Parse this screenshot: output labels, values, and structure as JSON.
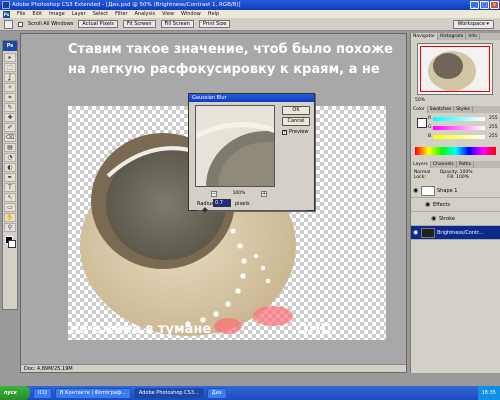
{
  "window": {
    "title": "Adobe Photoshop CS3 Extended - [Диз.psd @ 50% (Brightness/Contrast 1, RGB/8)]",
    "controls": [
      "_",
      "□",
      "x"
    ]
  },
  "menu": {
    "logo": "Ps",
    "items": [
      "File",
      "Edit",
      "Image",
      "Layer",
      "Select",
      "Filter",
      "Analysis",
      "View",
      "Window",
      "Help"
    ]
  },
  "options": {
    "scroll_all_label": "Scroll All Windows",
    "buttons": [
      "Actual Pixels",
      "Fit Screen",
      "Fill Screen",
      "Print Size"
    ],
    "workspace_label": "Workspace ▾"
  },
  "toolbox": {
    "logo": "Ps",
    "tools": [
      "▸",
      "⬚",
      "ʆ",
      "✧",
      "⌗",
      "✎",
      "✚",
      "✐",
      "⌫",
      "▤",
      "◔",
      "◐",
      "✒",
      "T",
      "↖",
      "▭",
      "✋",
      "⚲"
    ]
  },
  "annotation": {
    "main_text": "Ставим такое значение, чтоб было похоже на легкую расфокусировку к краям, а не",
    "bottom_left": "на ежика в тумане",
    "bottom_right": ":)))))"
  },
  "dialog": {
    "title": "Gaussian Blur",
    "ok_label": "OK",
    "cancel_label": "Cancel",
    "preview_checked": true,
    "preview_label": "Preview",
    "zoom_value": "100%",
    "zoom_minus": "−",
    "zoom_plus": "+",
    "radius_label": "Radius:",
    "radius_value": "0.7",
    "radius_unit": "pixels"
  },
  "document": {
    "status": "Doc: 4,89M/25,19M"
  },
  "panels": {
    "navigator_tabs": [
      "Navigator",
      "Histogram",
      "Info"
    ],
    "zoom_value": "50%",
    "color_tabs": [
      "Color",
      "Swatches",
      "Styles"
    ],
    "color_channels": [
      {
        "name": "R",
        "value": "255"
      },
      {
        "name": "G",
        "value": "255"
      },
      {
        "name": "B",
        "value": "255"
      }
    ],
    "layers_tabs": [
      "Layers",
      "Channels",
      "Paths"
    ],
    "blend_mode": "Normal",
    "opacity_label": "Opacity: 100%",
    "lock_label": "Lock:",
    "fill_label": "Fill: 100%",
    "layers": [
      {
        "name": "Shape 1",
        "selected": false
      },
      {
        "name": "Effects",
        "selected": false
      },
      {
        "name": "Stroke",
        "selected": false
      },
      {
        "name": "Brightness/Contr...",
        "selected": true
      }
    ]
  },
  "taskbar": {
    "start_label": "пуск",
    "items": [
      "ICQ",
      "В Контакте | Фотограф...",
      "Adobe Photoshop CS3...",
      "Диз"
    ],
    "time": "18:35"
  }
}
